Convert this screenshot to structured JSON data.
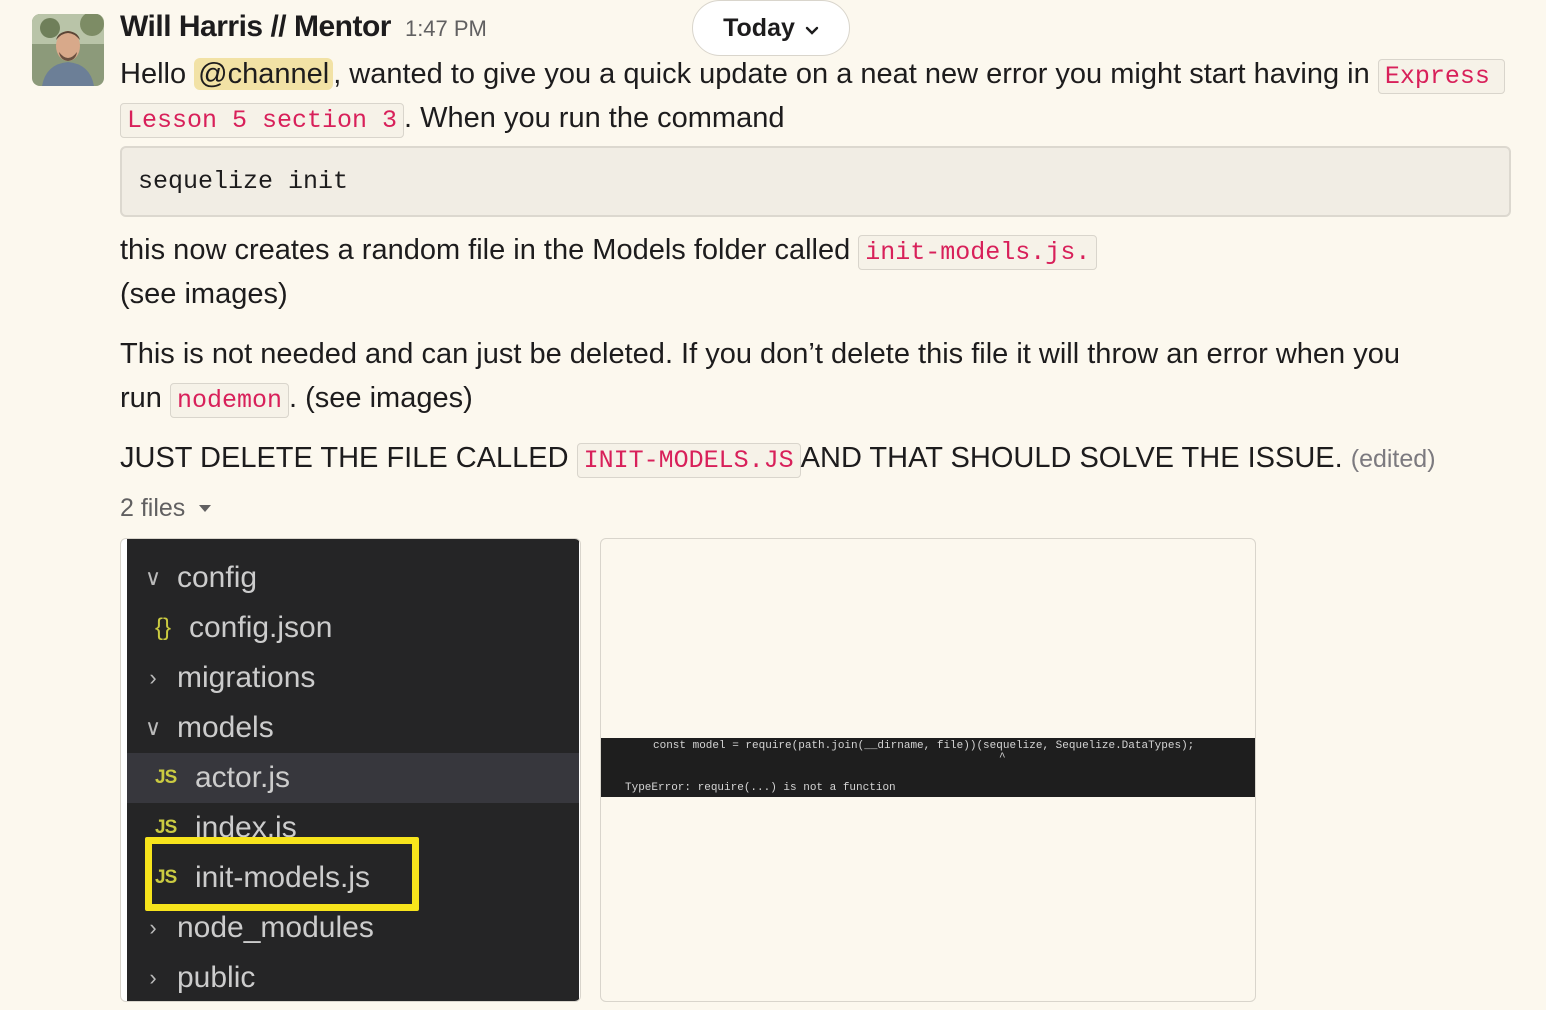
{
  "message": {
    "sender": "Will Harris // Mentor",
    "time": "1:47 PM",
    "date_divider": "Today",
    "line1_pre": "Hello ",
    "mention": "@channel",
    "line1_post": ", wanted to give you a quick update on a neat new error you might start having in ",
    "code_express": "Express",
    "code_lesson": "Lesson 5 section 3",
    "line2_post": ".  When you run the command",
    "command": "sequelize init",
    "line3_pre": " this now creates a random file in the Models folder called ",
    "code_initmodels": "init-models.js.",
    "line4": "(see images)",
    "line5": "This is not needed and can just be deleted.  If you don’t delete this file it will throw an error when you",
    "line6_pre": "run ",
    "code_nodemon": "nodemon",
    "line6_post": ".  (see images)",
    "line7_pre": "JUST DELETE THE FILE CALLED ",
    "code_initupper": "INIT-MODELS.JS",
    "line7_post": "AND THAT SHOULD SOLVE THE ISSUE.",
    "edited": "(edited)",
    "files_label": "2 files"
  },
  "attachment1": {
    "tree": [
      {
        "label": "config",
        "icon": "chevron-down-icon",
        "arrow": "∨"
      },
      {
        "label": "config.json",
        "icon": "json-braces-icon",
        "prefix": "{}"
      },
      {
        "label": "migrations",
        "icon": "chevron-right-icon",
        "arrow": "›"
      },
      {
        "label": "models",
        "icon": "chevron-down-icon",
        "arrow": "∨"
      },
      {
        "label": "actor.js",
        "icon": "js-file-icon",
        "prefix": "JS"
      },
      {
        "label": "index.js",
        "icon": "js-file-icon",
        "prefix": "JS"
      },
      {
        "label": "init-models.js",
        "icon": "js-file-icon",
        "prefix": "JS"
      },
      {
        "label": "node_modules",
        "icon": "chevron-right-icon",
        "arrow": "›"
      },
      {
        "label": "public",
        "icon": "chevron-right-icon",
        "arrow": "›"
      }
    ],
    "highlight_color": "#f7e41c"
  },
  "attachment2": {
    "line1": "const model = require(path.join(__dirname, file))(sequelize, Sequelize.DataTypes);",
    "caret": "^",
    "line2": "TypeError: require(...) is not a function"
  },
  "colors": {
    "background": "#fcf8ee",
    "code_text": "#d8205a",
    "mention_bg": "#f2e2a5"
  }
}
